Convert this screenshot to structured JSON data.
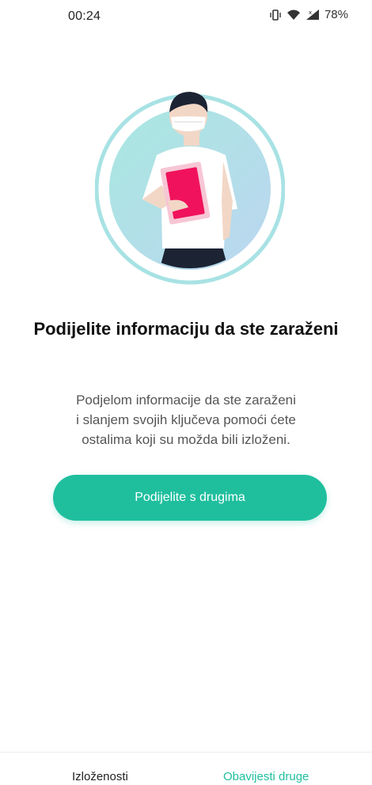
{
  "status_bar": {
    "time": "00:24",
    "battery": "78%",
    "icons": [
      "vibrate-icon",
      "wifi-icon",
      "signal-icon"
    ]
  },
  "illustration": {
    "icon": "person-with-mask-illustration"
  },
  "main": {
    "headline": "Podijelite informaciju da ste zaraženi",
    "description_lines": [
      "Podjelom informacije da ste zaraženi",
      "i slanjem svojih ključeva pomoći ćete",
      "ostalima koji su možda bili izloženi."
    ],
    "button_label": "Podijelite s drugima"
  },
  "bottom_nav": {
    "items": [
      {
        "label": "Izloženosti",
        "active": false
      },
      {
        "label": "Obavijesti druge",
        "active": true
      }
    ]
  },
  "colors": {
    "accent": "#1fbf9e",
    "illustration_card": "#f0125c"
  }
}
